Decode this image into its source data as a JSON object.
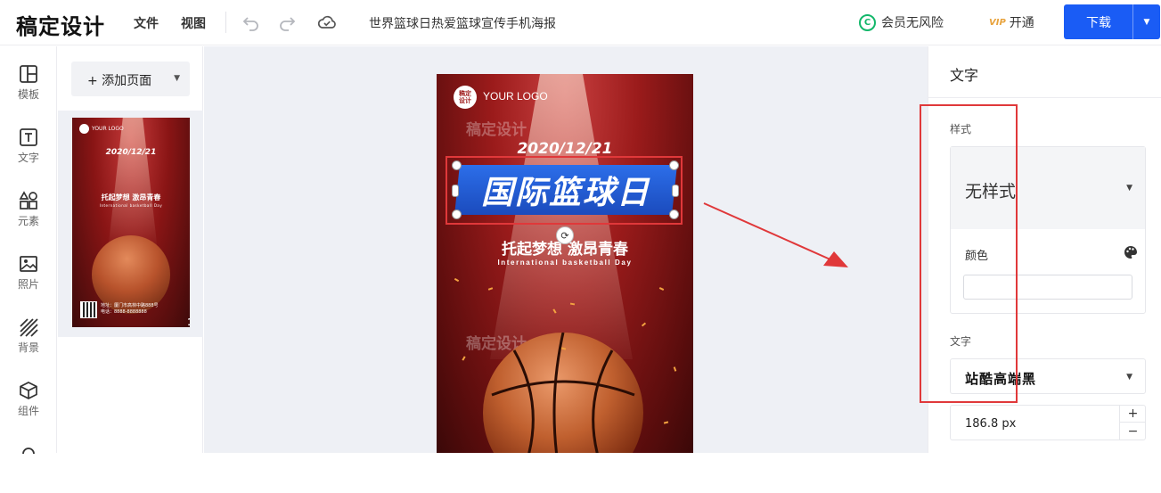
{
  "header": {
    "app_name": "稿定设计",
    "menu": [
      "文件",
      "视图"
    ],
    "doc_title": "世界篮球日热爱篮球宣传手机海报",
    "member_icon_glyph": "C",
    "member_label": "会员无风险",
    "vip_badge": "VIP",
    "open_label": "开通",
    "download_label": "下载",
    "download_arrow": "▼"
  },
  "rail": {
    "items": [
      {
        "label": "模板",
        "icon": "layout-icon"
      },
      {
        "label": "文字",
        "icon": "text-icon"
      },
      {
        "label": "元素",
        "icon": "shapes-icon"
      },
      {
        "label": "照片",
        "icon": "image-icon"
      },
      {
        "label": "背景",
        "icon": "background-icon"
      },
      {
        "label": "组件",
        "icon": "cube-icon"
      }
    ]
  },
  "pages": {
    "add_label": "+ 添加页面",
    "dropdown_glyph": "▼",
    "thumbnail": {
      "logo": "YOUR LOGO",
      "date": "2020/12/21",
      "subtitle": "托起梦想 激昂青春",
      "english": "International basketball Day",
      "address_line1": "地址：厦门市高林中路888号",
      "address_line2": "电话：8888-8888888",
      "page_number": "1"
    }
  },
  "poster": {
    "logo_mark": "稿定\n设计",
    "logo_text": "YOUR LOGO",
    "watermark": "稿定设计",
    "date": "2020/12/21",
    "title": "国际篮球日",
    "subtitle": "托起梦想 激昂青春",
    "english": "International basketball Day",
    "rotate_glyph": "⟳"
  },
  "props": {
    "title": "文字",
    "style_label": "样式",
    "style_value": "无样式",
    "dropdown_glyph": "▼",
    "color_label": "颜色",
    "color_value": "",
    "font_label": "文字",
    "font_value": "站酷高端黑",
    "size_value": "186.8 px",
    "plus_glyph": "+",
    "minus_glyph": "−"
  },
  "colors": {
    "accent": "#1a5cf5",
    "highlight": "#e0383a",
    "member_green": "#12b76a",
    "poster_red": "#9b1b1b",
    "title_blue": "#2c6ee9"
  }
}
